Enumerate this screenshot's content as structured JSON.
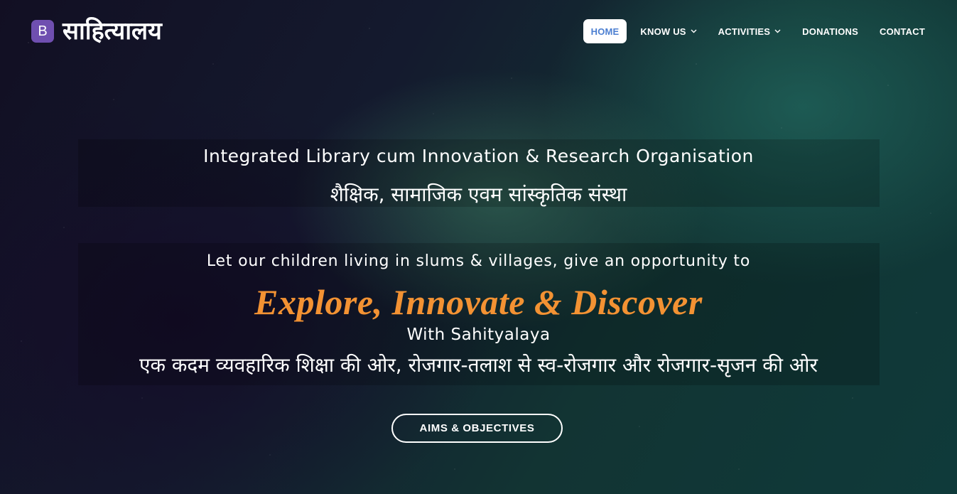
{
  "brand": {
    "logo_letter": "B",
    "name": "साहित्यालय",
    "logo_color": "#6f4fb0"
  },
  "nav": {
    "items": [
      {
        "label": "HOME",
        "active": true,
        "dropdown": false
      },
      {
        "label": "KNOW US",
        "active": false,
        "dropdown": true
      },
      {
        "label": "ACTIVITIES",
        "active": false,
        "dropdown": true
      },
      {
        "label": "DONATIONS",
        "active": false,
        "dropdown": false
      },
      {
        "label": "CONTACT",
        "active": false,
        "dropdown": false
      }
    ],
    "caret_icon": "chevron-down-icon",
    "active_text_color": "#4c7fd1"
  },
  "hero": {
    "tagline_en": "Integrated Library cum Innovation & Research Organisation",
    "tagline_hi": "शैक्षिक, सामाजिक एवम सांस्कृतिक संस्था",
    "mission_en": "Let our children living in slums & villages, give an opportunity to",
    "headline": "Explore, Innovate & Discover",
    "headline_color": "#f39233",
    "with_line": "With Sahityalaya",
    "slogan_hi": "एक कदम व्यवहारिक शिक्षा की ओर, रोजगार-तलाश से स्व-रोजगार और रोजगार-सृजन की ओर",
    "cta_label": "AIMS & OBJECTIVES"
  }
}
